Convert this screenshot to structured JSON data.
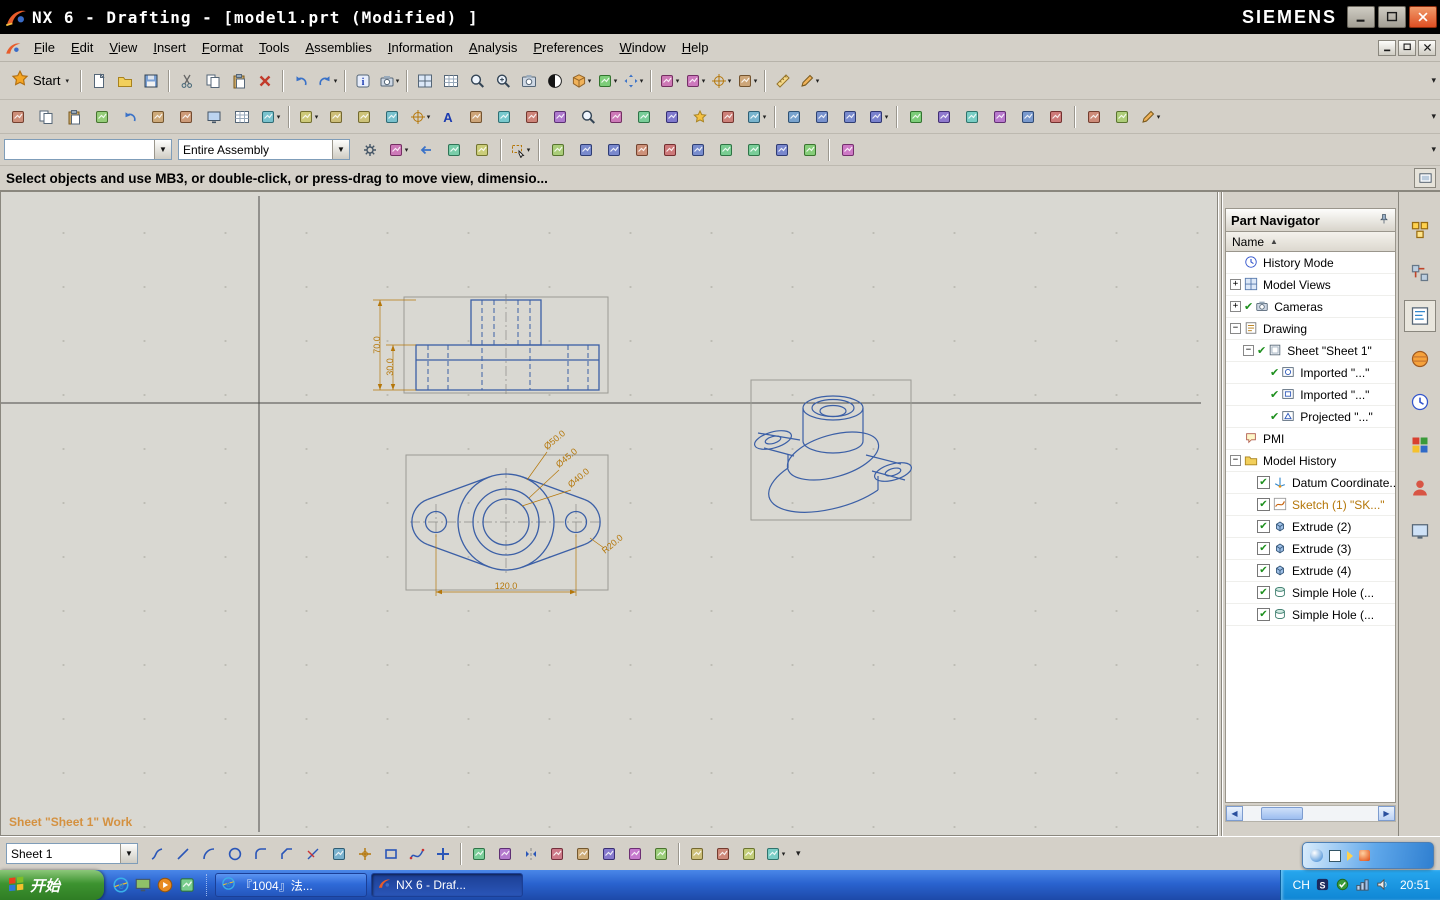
{
  "window": {
    "title": "NX 6 - Drafting - [model1.prt (Modified) ]",
    "brand": "SIEMENS"
  },
  "menubar": {
    "items": [
      "File",
      "Edit",
      "View",
      "Insert",
      "Format",
      "Tools",
      "Assemblies",
      "Information",
      "Analysis",
      "Preferences",
      "Window",
      "Help"
    ]
  },
  "toolbar1": {
    "start_label": "Start"
  },
  "combos": {
    "selection_filter": "",
    "selection_scope": "Entire Assembly",
    "sheet": "Sheet 1"
  },
  "prompt": {
    "text": "Select objects and use MB3, or double-click, or press-drag to move view, dimensio..."
  },
  "drawing": {
    "sheet_status": "Sheet \"Sheet 1\" Work",
    "dims": {
      "height": "70.0",
      "base_height": "30.0",
      "dia_outer": "Ø50.0",
      "dia_mid": "Ø45.0",
      "dia_bore": "Ø40.0",
      "lobe_radius": "R20.0",
      "length": "120.0"
    }
  },
  "part_navigator": {
    "title": "Part Navigator",
    "column": "Name",
    "items": [
      {
        "label": "History Mode",
        "icon": "clock",
        "level": 0
      },
      {
        "label": "Model Views",
        "icon": "views",
        "level": 0,
        "expand": "plus"
      },
      {
        "label": "Cameras",
        "icon": "camera",
        "level": 0,
        "expand": "plus",
        "check": true
      },
      {
        "label": "Drawing",
        "icon": "drawing",
        "level": 0,
        "expand": "minus"
      },
      {
        "label": "Sheet \"Sheet 1\"",
        "icon": "sheet",
        "level": 1,
        "expand": "minus",
        "check": true
      },
      {
        "label": "Imported \"...\"",
        "icon": "imported",
        "level": 2,
        "check": true
      },
      {
        "label": "Imported \"...\"",
        "icon": "imported2",
        "level": 2,
        "check": true
      },
      {
        "label": "Projected \"...\"",
        "icon": "projected",
        "level": 2,
        "check": true
      },
      {
        "label": "PMI",
        "icon": "pmi",
        "level": 0
      },
      {
        "label": "Model History",
        "icon": "folder",
        "level": 0,
        "expand": "minus"
      },
      {
        "label": "Datum Coordinate...",
        "icon": "datum",
        "level": 1,
        "checkbox": true
      },
      {
        "label": "Sketch (1) \"SK...\"",
        "icon": "sketch",
        "level": 1,
        "checkbox": true,
        "muted": true
      },
      {
        "label": "Extrude (2)",
        "icon": "extrude",
        "level": 1,
        "checkbox": true
      },
      {
        "label": "Extrude (3)",
        "icon": "extrude",
        "level": 1,
        "checkbox": true
      },
      {
        "label": "Extrude (4)",
        "icon": "extrude",
        "level": 1,
        "checkbox": true
      },
      {
        "label": "Simple Hole (...",
        "icon": "hole",
        "level": 1,
        "checkbox": true
      },
      {
        "label": "Simple Hole (...",
        "icon": "hole",
        "level": 1,
        "checkbox": true
      }
    ]
  },
  "icons": {
    "row1": [
      {
        "n": "new-button",
        "g": "doc"
      },
      {
        "n": "open-button",
        "g": "folder"
      },
      {
        "n": "save-button",
        "g": "disk"
      },
      "sep",
      {
        "n": "cut-button",
        "g": "cut"
      },
      {
        "n": "copy-button",
        "g": "copy"
      },
      {
        "n": "paste-button",
        "g": "paste"
      },
      {
        "n": "delete-button",
        "g": "xred"
      },
      "sep",
      {
        "n": "undo-button",
        "g": "undo"
      },
      {
        "n": "redo-button",
        "g": "redo",
        "dd": true
      },
      "sep",
      {
        "n": "information-button",
        "g": "info"
      },
      {
        "n": "visualize-button",
        "g": "camera",
        "dd": true
      },
      "sep",
      {
        "n": "fit-view-button",
        "g": "layout"
      },
      {
        "n": "window-layout-button",
        "g": "grid2"
      },
      {
        "n": "zoom-window-button",
        "g": "zoomwin"
      },
      {
        "n": "zoom-in-button",
        "g": "zoomin"
      },
      {
        "n": "snapshot-button",
        "g": "snapshot"
      },
      {
        "n": "shaded-view-button",
        "g": "shaded"
      },
      {
        "n": "orient-view-button",
        "g": "cube",
        "dd": true
      },
      {
        "n": "display-style-button",
        "g": "square",
        "dd": true
      },
      {
        "n": "pan-button",
        "g": "pan",
        "dd": true
      },
      "sep",
      {
        "n": "datum-plane-button",
        "g": "planeY",
        "dd": true
      },
      {
        "n": "sketch-task-button",
        "g": "sketchT",
        "dd": true
      },
      {
        "n": "snap-options-button",
        "g": "crossT",
        "dd": true
      },
      {
        "n": "move-object-button",
        "g": "moveI",
        "dd": true
      },
      "sep",
      {
        "n": "measure-button",
        "g": "ruler"
      },
      {
        "n": "edit-object-display-button",
        "g": "pencil",
        "dd": true
      }
    ],
    "row2": [
      {
        "n": "new-sheet-button",
        "g": "sheetN"
      },
      {
        "n": "view-create-button",
        "g": "copy"
      },
      {
        "n": "edit-sheet-button",
        "g": "paste"
      },
      {
        "n": "pin-view-button",
        "g": "pinI"
      },
      {
        "n": "update-views-button",
        "g": "undo"
      },
      {
        "n": "rotate-view-button",
        "g": "orbit"
      },
      {
        "n": "orbit-view-button",
        "g": "orbit2"
      },
      {
        "n": "display-sheet-button",
        "g": "monitor"
      },
      {
        "n": "sheet-setup-button",
        "g": "grid2"
      },
      {
        "n": "base-view-button",
        "g": "views2",
        "dd": true
      },
      "sep",
      {
        "n": "dimension-button",
        "g": "dimI",
        "dd": true
      },
      {
        "n": "rapid-dimension-button",
        "g": "dimA"
      },
      {
        "n": "feature-parameters-button",
        "g": "dimD"
      },
      {
        "n": "grid-settings-button",
        "g": "gridC"
      },
      {
        "n": "centerline-button",
        "g": "crossT",
        "dd": true
      },
      {
        "n": "text-button",
        "g": "textA"
      },
      {
        "n": "note-button",
        "g": "noteI"
      },
      {
        "n": "id-symbol-button",
        "g": "balloon"
      },
      {
        "n": "surface-finish-button",
        "g": "surfF"
      },
      {
        "n": "weld-symbol-button",
        "g": "weld"
      },
      {
        "n": "magnify-button",
        "g": "zoomwin"
      },
      {
        "n": "remove-button",
        "g": "xgray"
      },
      {
        "n": "crosshair-target-button",
        "g": "crossT2"
      },
      {
        "n": "datum-target-button",
        "g": "anchor"
      },
      {
        "n": "datum-feature-button",
        "g": "star"
      },
      {
        "n": "gdt-button",
        "g": "spark"
      },
      {
        "n": "image-button",
        "g": "imageI",
        "dd": true
      },
      "sep",
      {
        "n": "center-mark-button",
        "g": "targetC"
      },
      {
        "n": "bolt-circle-button",
        "g": "targetO"
      },
      {
        "n": "offset-center-button",
        "g": "brL"
      },
      {
        "n": "automatic-centerline-button",
        "g": "brR",
        "dd": true
      },
      "sep",
      {
        "n": "annotation-button",
        "g": "textA2"
      },
      {
        "n": "section-line-button",
        "g": "flash"
      },
      {
        "n": "view-boundary-button",
        "g": "grid3"
      },
      {
        "n": "model-view-button",
        "g": "cube2"
      },
      {
        "n": "view-alignment-button",
        "g": "arrowR"
      },
      {
        "n": "animation-button",
        "g": "anim"
      },
      "sep",
      {
        "n": "spreadsheet-button",
        "g": "calc"
      },
      {
        "n": "tabular-note-button",
        "g": "tableI"
      },
      {
        "n": "edit-annotation-button",
        "g": "pencil",
        "dd": true
      }
    ],
    "row3": [
      {
        "n": "snap-gear-button",
        "g": "gearB"
      },
      {
        "n": "detail-options-button",
        "g": "boxDD",
        "dd": true
      },
      {
        "n": "back-arrow-button",
        "g": "arrowL"
      },
      {
        "n": "share-selection-button",
        "g": "shareI"
      },
      {
        "n": "up-one-level-button",
        "g": "upI"
      },
      "sep",
      {
        "n": "select-rectangle-button",
        "g": "selRect",
        "dd": true
      },
      "sep",
      {
        "n": "snap-point-button",
        "g": "snapG"
      },
      {
        "n": "end-point-button",
        "g": "slash1"
      },
      {
        "n": "mid-point-button",
        "g": "slash2"
      },
      {
        "n": "control-point-button",
        "g": "arcC"
      },
      {
        "n": "intersection-point-button",
        "g": "interS"
      },
      {
        "n": "arc-center-button",
        "g": "circDot"
      },
      {
        "n": "quadrant-point-button",
        "g": "circQ"
      },
      {
        "n": "existing-point-button",
        "g": "plusP"
      },
      {
        "n": "point-on-curve-button",
        "g": "slash3"
      },
      {
        "n": "snap-settings-button",
        "g": "gearB2"
      },
      "sep",
      {
        "n": "work-part-only-button",
        "g": "cubeG"
      }
    ],
    "sketch": [
      {
        "n": "profile-button",
        "g": "profileS"
      },
      {
        "n": "line-button",
        "g": "lineI"
      },
      {
        "n": "arc-button",
        "g": "arcI"
      },
      {
        "n": "circle-button",
        "g": "circleI"
      },
      {
        "n": "fillet-button",
        "g": "filletI"
      },
      {
        "n": "chamfer-button",
        "g": "chamferI"
      },
      {
        "n": "quick-trim-button",
        "g": "trimI"
      },
      {
        "n": "quick-extend-button",
        "g": "extI"
      },
      {
        "n": "cross-button",
        "g": "crossS"
      },
      {
        "n": "rectangle-button",
        "g": "rectI"
      },
      {
        "n": "studio-spline-button",
        "g": "splineI"
      },
      {
        "n": "add-existing-button",
        "g": "plusBig"
      },
      "sep",
      {
        "n": "offset-curve-button",
        "g": "offsetI"
      },
      {
        "n": "pattern-curve-button",
        "g": "patternI"
      },
      {
        "n": "mirror-curve-button",
        "g": "mirrorI"
      },
      {
        "n": "intersection-curve-button",
        "g": "interI"
      },
      {
        "n": "project-curve-button",
        "g": "projI"
      },
      {
        "n": "edit-curve-button",
        "g": "editC"
      },
      {
        "n": "constraints-button",
        "g": "constI"
      },
      {
        "n": "fit-curve-button",
        "g": "fitI"
      },
      "sep",
      {
        "n": "point-button",
        "g": "pointB"
      },
      {
        "n": "cylinder-button",
        "g": "cylI"
      },
      {
        "n": "sphere-button",
        "g": "blobI"
      },
      {
        "n": "grid-snap-button",
        "g": "grid4",
        "dd": true
      }
    ],
    "resource": [
      {
        "n": "assembly-navigator-tab",
        "g": "asmNav"
      },
      {
        "n": "constraint-navigator-tab",
        "g": "conNav"
      },
      {
        "n": "part-navigator-tab",
        "g": "partNav",
        "active": true
      },
      {
        "n": "reuse-library-tab",
        "g": "reuseI"
      },
      {
        "n": "history-tab",
        "g": "clock"
      },
      {
        "n": "palette-tab",
        "g": "paletteI"
      },
      {
        "n": "roles-tab",
        "g": "rolesI"
      },
      {
        "n": "system-scenes-tab",
        "g": "sysI"
      }
    ],
    "quick_launch": [
      {
        "n": "quicklaunch-browser",
        "g": "ieI"
      },
      {
        "n": "quicklaunch-desktop",
        "g": "deskI"
      },
      {
        "n": "quicklaunch-media",
        "g": "medI"
      },
      {
        "n": "quicklaunch-mail",
        "g": "othI"
      }
    ],
    "tray": [
      {
        "n": "tray-ime",
        "g": "sIcon"
      },
      {
        "n": "tray-antivirus",
        "g": "gnI"
      },
      {
        "n": "tray-network",
        "g": "netI"
      },
      {
        "n": "tray-volume",
        "g": "volI"
      }
    ]
  },
  "taskbar": {
    "start": "开始",
    "tasks": [
      {
        "label": "『1004』法...",
        "icon": "ieI"
      },
      {
        "label": "NX 6 - Draf...",
        "icon": "nxI",
        "active": true
      }
    ],
    "tray": {
      "lang": "CH",
      "time": "20:51"
    }
  }
}
